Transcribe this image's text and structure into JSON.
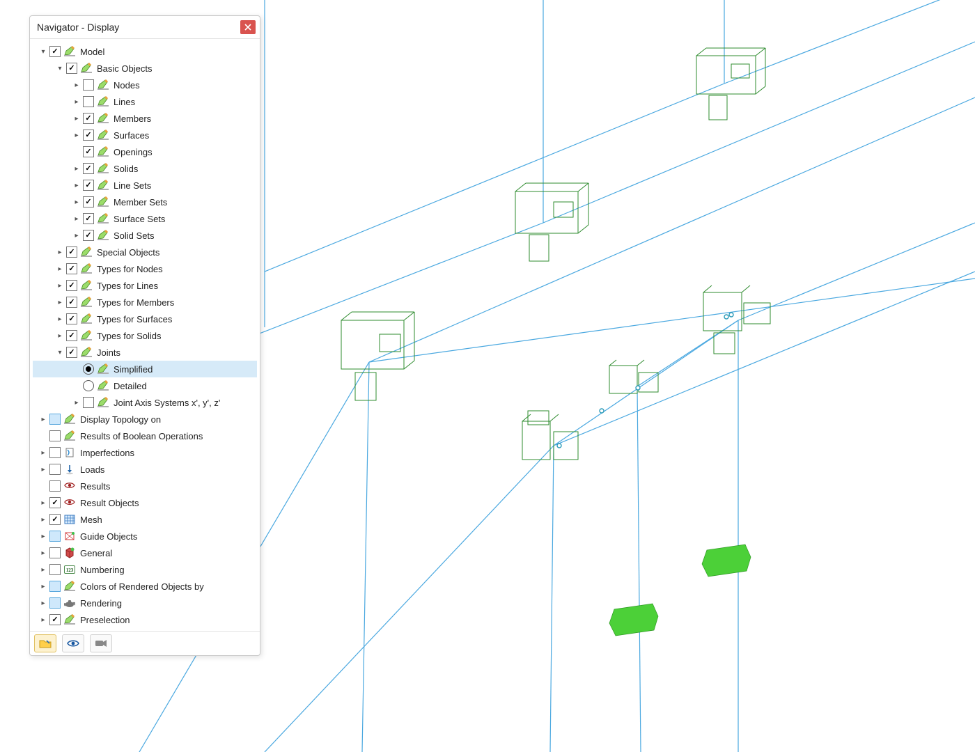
{
  "panel": {
    "title": "Navigator - Display"
  },
  "tree": [
    {
      "depth": 0,
      "toggle": "open",
      "type": "check",
      "checked": true,
      "iconKind": "pencil",
      "label": "Model"
    },
    {
      "depth": 1,
      "toggle": "open",
      "type": "check",
      "checked": true,
      "iconKind": "pencil",
      "label": "Basic Objects"
    },
    {
      "depth": 2,
      "toggle": "closed",
      "type": "check",
      "checked": false,
      "iconKind": "pencil",
      "label": "Nodes"
    },
    {
      "depth": 2,
      "toggle": "closed",
      "type": "check",
      "checked": false,
      "iconKind": "pencil",
      "label": "Lines"
    },
    {
      "depth": 2,
      "toggle": "closed",
      "type": "check",
      "checked": true,
      "iconKind": "pencil",
      "label": "Members"
    },
    {
      "depth": 2,
      "toggle": "closed",
      "type": "check",
      "checked": true,
      "iconKind": "pencil",
      "label": "Surfaces"
    },
    {
      "depth": 2,
      "toggle": "none",
      "type": "check",
      "checked": true,
      "iconKind": "pencil",
      "label": "Openings"
    },
    {
      "depth": 2,
      "toggle": "closed",
      "type": "check",
      "checked": true,
      "iconKind": "pencil",
      "label": "Solids"
    },
    {
      "depth": 2,
      "toggle": "closed",
      "type": "check",
      "checked": true,
      "iconKind": "pencil",
      "label": "Line Sets"
    },
    {
      "depth": 2,
      "toggle": "closed",
      "type": "check",
      "checked": true,
      "iconKind": "pencil",
      "label": "Member Sets"
    },
    {
      "depth": 2,
      "toggle": "closed",
      "type": "check",
      "checked": true,
      "iconKind": "pencil",
      "label": "Surface Sets"
    },
    {
      "depth": 2,
      "toggle": "closed",
      "type": "check",
      "checked": true,
      "iconKind": "pencil",
      "label": "Solid Sets"
    },
    {
      "depth": 1,
      "toggle": "closed",
      "type": "check",
      "checked": true,
      "iconKind": "pencil",
      "label": "Special Objects"
    },
    {
      "depth": 1,
      "toggle": "closed",
      "type": "check",
      "checked": true,
      "iconKind": "pencil",
      "label": "Types for Nodes"
    },
    {
      "depth": 1,
      "toggle": "closed",
      "type": "check",
      "checked": true,
      "iconKind": "pencil",
      "label": "Types for Lines"
    },
    {
      "depth": 1,
      "toggle": "closed",
      "type": "check",
      "checked": true,
      "iconKind": "pencil",
      "label": "Types for Members"
    },
    {
      "depth": 1,
      "toggle": "closed",
      "type": "check",
      "checked": true,
      "iconKind": "pencil",
      "label": "Types for Surfaces"
    },
    {
      "depth": 1,
      "toggle": "closed",
      "type": "check",
      "checked": true,
      "iconKind": "pencil",
      "label": "Types for Solids"
    },
    {
      "depth": 1,
      "toggle": "open",
      "type": "check",
      "checked": true,
      "iconKind": "pencil",
      "label": "Joints"
    },
    {
      "depth": 2,
      "toggle": "none",
      "type": "radio",
      "checked": true,
      "iconKind": "pencil",
      "label": "Simplified",
      "selected": true
    },
    {
      "depth": 2,
      "toggle": "none",
      "type": "radio",
      "checked": false,
      "iconKind": "pencil",
      "label": "Detailed"
    },
    {
      "depth": 2,
      "toggle": "closed",
      "type": "check",
      "checked": false,
      "iconKind": "pencil",
      "label": "Joint Axis Systems x', y', z'"
    },
    {
      "depth": 0,
      "toggle": "closed",
      "type": "blue",
      "checked": false,
      "iconKind": "pencil",
      "label": "Display Topology on"
    },
    {
      "depth": 0,
      "toggle": "none",
      "type": "check",
      "checked": false,
      "iconKind": "pencil",
      "label": "Results of Boolean Operations"
    },
    {
      "depth": 0,
      "toggle": "closed",
      "type": "check",
      "checked": false,
      "iconKind": "imperf",
      "label": "Imperfections"
    },
    {
      "depth": 0,
      "toggle": "closed",
      "type": "check",
      "checked": false,
      "iconKind": "loads",
      "label": "Loads"
    },
    {
      "depth": 0,
      "toggle": "none",
      "type": "check",
      "checked": false,
      "iconKind": "eye",
      "label": "Results"
    },
    {
      "depth": 0,
      "toggle": "closed",
      "type": "check",
      "checked": true,
      "iconKind": "eye",
      "label": "Result Objects"
    },
    {
      "depth": 0,
      "toggle": "closed",
      "type": "check",
      "checked": true,
      "iconKind": "mesh",
      "label": "Mesh"
    },
    {
      "depth": 0,
      "toggle": "closed",
      "type": "blue",
      "checked": false,
      "iconKind": "guide",
      "label": "Guide Objects"
    },
    {
      "depth": 0,
      "toggle": "closed",
      "type": "check",
      "checked": false,
      "iconKind": "general",
      "label": "General"
    },
    {
      "depth": 0,
      "toggle": "closed",
      "type": "check",
      "checked": false,
      "iconKind": "numbering",
      "label": "Numbering"
    },
    {
      "depth": 0,
      "toggle": "closed",
      "type": "blue",
      "checked": false,
      "iconKind": "pencil",
      "label": "Colors of Rendered Objects by"
    },
    {
      "depth": 0,
      "toggle": "closed",
      "type": "blue",
      "checked": false,
      "iconKind": "teapot",
      "label": "Rendering"
    },
    {
      "depth": 0,
      "toggle": "closed",
      "type": "check",
      "checked": true,
      "iconKind": "pencil",
      "label": "Preselection"
    }
  ],
  "footer_buttons": [
    "navigator-project",
    "navigator-display",
    "navigator-views"
  ]
}
